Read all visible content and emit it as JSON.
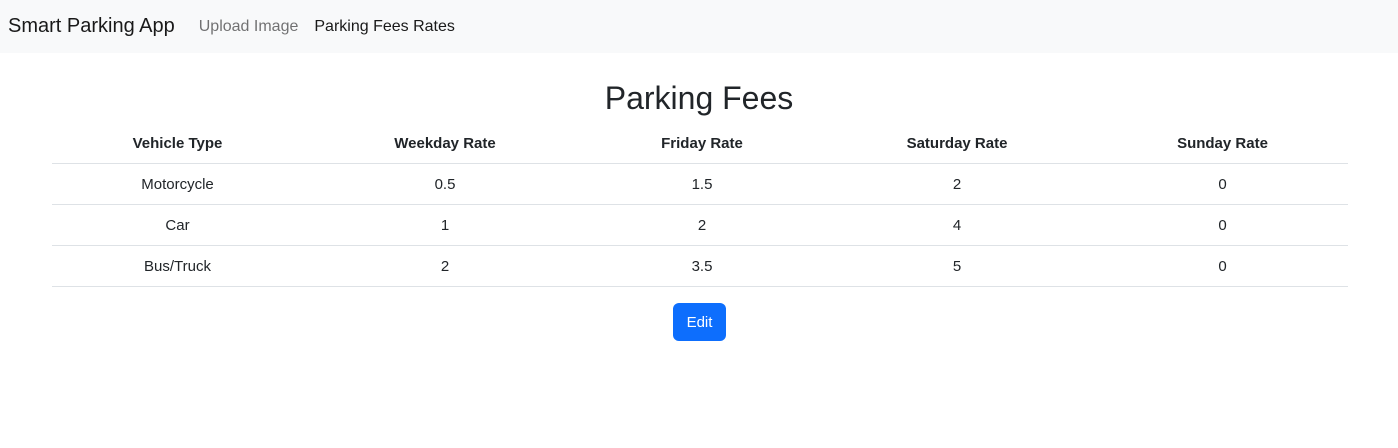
{
  "navbar": {
    "brand": "Smart Parking App",
    "links": [
      {
        "label": "Upload Image",
        "active": false
      },
      {
        "label": "Parking Fees Rates",
        "active": true
      }
    ]
  },
  "main": {
    "title": "Parking Fees",
    "table": {
      "headers": [
        "Vehicle Type",
        "Weekday Rate",
        "Friday Rate",
        "Saturday Rate",
        "Sunday Rate"
      ],
      "rows": [
        [
          "Motorcycle",
          "0.5",
          "1.5",
          "2",
          "0"
        ],
        [
          "Car",
          "1",
          "2",
          "4",
          "0"
        ],
        [
          "Bus/Truck",
          "2",
          "3.5",
          "5",
          "0"
        ]
      ]
    },
    "edit_label": "Edit"
  },
  "colors": {
    "navbar_bg": "#f8f9fa",
    "primary": "#0d6efd",
    "border": "#dee2e6"
  }
}
